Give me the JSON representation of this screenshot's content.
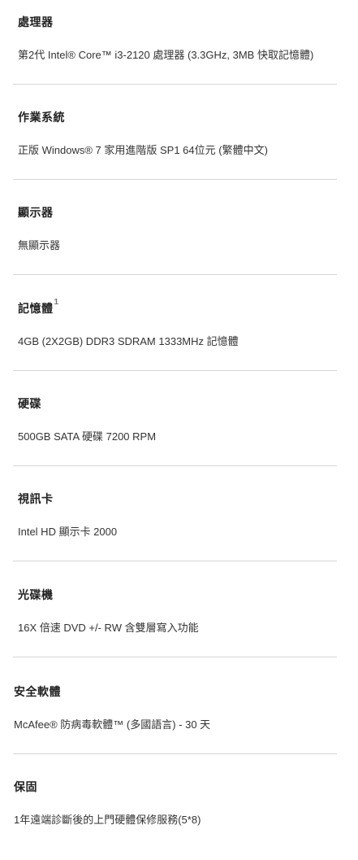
{
  "specs": [
    {
      "title": "處理器",
      "sup": "",
      "value": "第2代 Intel® Core™ i3-2120 處理器 (3.3GHz, 3MB 快取記憶體)"
    },
    {
      "title": "作業系統",
      "sup": "",
      "value": "正版 Windows® 7 家用進階版 SP1 64位元 (繁體中文)"
    },
    {
      "title": "顯示器",
      "sup": "",
      "value": "無顯示器"
    },
    {
      "title": "記憶體",
      "sup": "1",
      "value": "4GB (2X2GB) DDR3 SDRAM 1333MHz 記憶體"
    },
    {
      "title": "硬碟",
      "sup": "",
      "value": "500GB SATA 硬碟 7200 RPM"
    },
    {
      "title": "視訊卡",
      "sup": "",
      "value": "Intel HD 顯示卡 2000"
    },
    {
      "title": "光碟機",
      "sup": "",
      "value": "16X 倍速 DVD +/- RW 含雙層寫入功能"
    },
    {
      "title": "安全軟體",
      "sup": "",
      "value": "McAfee® 防病毒軟體™ (多國語言) - 30 天"
    },
    {
      "title": "保固",
      "sup": "",
      "value": "1年遠端診斷後的上門硬體保修服務(5*8)"
    }
  ]
}
